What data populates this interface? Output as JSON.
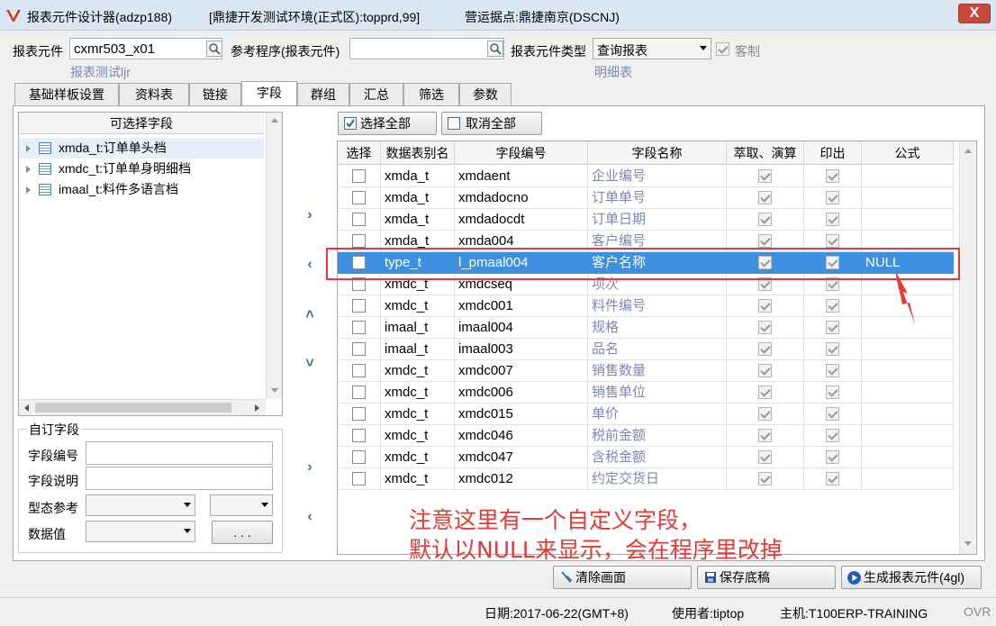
{
  "window": {
    "title_1": "报表元件设计器(adzp188)",
    "title_2": "[鼎捷开发测试环境(正式区):topprd,99]",
    "title_3": "营运据点:鼎捷南京(DSCNJ)",
    "close_label": "X"
  },
  "header": {
    "component_label": "报表元件",
    "component_value": "cxmr503_x01",
    "component_desc": "报表测试ljr",
    "ref_label": "参考程序(报表元件)",
    "ref_value": "",
    "type_label": "报表元件类型",
    "type_value": "查询报表",
    "type_desc": "明细表",
    "custom_label": "客制",
    "custom_checked": true
  },
  "tabs": [
    "基础样板设置",
    "资料表",
    "链接",
    "字段",
    "群组",
    "汇总",
    "筛选",
    "参数"
  ],
  "active_tab": "字段",
  "tree": {
    "header": "可选择字段",
    "items": [
      "xmda_t:订单单头档",
      "xmdc_t:订单单身明细档",
      "imaal_t:料件多语言档"
    ]
  },
  "custom_field": {
    "group_title": "自订字段",
    "code_label": "字段编号",
    "code_value": "",
    "desc_label": "字段说明",
    "desc_value": "",
    "type_label": "型态参考",
    "type_value": "",
    "type_value2": "",
    "data_label": "数据值",
    "data_value": "",
    "ellipsis_label": ". . ."
  },
  "grid": {
    "select_all_label": "选择全部",
    "cancel_all_label": "取消全部",
    "columns": [
      "选择",
      "数据表别名",
      "字段编号",
      "字段名称",
      "萃取、演算",
      "印出",
      "公式"
    ],
    "rows": [
      {
        "alias": "xmda_t",
        "code": "xmdaent",
        "name": "企业编号",
        "extract": true,
        "print": true,
        "formula": "",
        "selected": false
      },
      {
        "alias": "xmda_t",
        "code": "xmdadocno",
        "name": "订单单号",
        "extract": true,
        "print": true,
        "formula": "",
        "selected": false
      },
      {
        "alias": "xmda_t",
        "code": "xmdadocdt",
        "name": "订单日期",
        "extract": true,
        "print": true,
        "formula": "",
        "selected": false
      },
      {
        "alias": "xmda_t",
        "code": "xmda004",
        "name": "客户编号",
        "extract": true,
        "print": true,
        "formula": "",
        "selected": false
      },
      {
        "alias": "type_t",
        "code": "l_pmaal004",
        "name": "客户名称",
        "extract": true,
        "print": true,
        "formula": "NULL",
        "selected": true
      },
      {
        "alias": "xmdc_t",
        "code": "xmdcseq",
        "name": "项次",
        "extract": true,
        "print": true,
        "formula": "",
        "selected": false
      },
      {
        "alias": "xmdc_t",
        "code": "xmdc001",
        "name": "料件编号",
        "extract": true,
        "print": true,
        "formula": "",
        "selected": false
      },
      {
        "alias": "imaal_t",
        "code": "imaal004",
        "name": "规格",
        "extract": true,
        "print": true,
        "formula": "",
        "selected": false
      },
      {
        "alias": "imaal_t",
        "code": "imaal003",
        "name": "品名",
        "extract": true,
        "print": true,
        "formula": "",
        "selected": false
      },
      {
        "alias": "xmdc_t",
        "code": "xmdc007",
        "name": "销售数量",
        "extract": true,
        "print": true,
        "formula": "",
        "selected": false
      },
      {
        "alias": "xmdc_t",
        "code": "xmdc006",
        "name": "销售单位",
        "extract": true,
        "print": true,
        "formula": "",
        "selected": false
      },
      {
        "alias": "xmdc_t",
        "code": "xmdc015",
        "name": "单价",
        "extract": true,
        "print": true,
        "formula": "",
        "selected": false
      },
      {
        "alias": "xmdc_t",
        "code": "xmdc046",
        "name": "税前金额",
        "extract": true,
        "print": true,
        "formula": "",
        "selected": false
      },
      {
        "alias": "xmdc_t",
        "code": "xmdc047",
        "name": "含税金额",
        "extract": true,
        "print": true,
        "formula": "",
        "selected": false
      },
      {
        "alias": "xmdc_t",
        "code": "xmdc012",
        "name": "约定交货日",
        "extract": true,
        "print": true,
        "formula": "",
        "selected": false
      }
    ]
  },
  "annotation": {
    "line1": "注意这里有一个自定义字段，",
    "line2": "默认以NULL来显示，会在程序里改掉",
    "color": "#e53935"
  },
  "actions": {
    "clear_label": "清除画面",
    "save_label": "保存底稿",
    "generate_label": "生成报表元件(4gl)"
  },
  "status": {
    "date": "日期:2017-06-22(GMT+8)",
    "user": "使用者:tiptop",
    "host": "主机:T100ERP-TRAINING",
    "mode": "OVR"
  }
}
